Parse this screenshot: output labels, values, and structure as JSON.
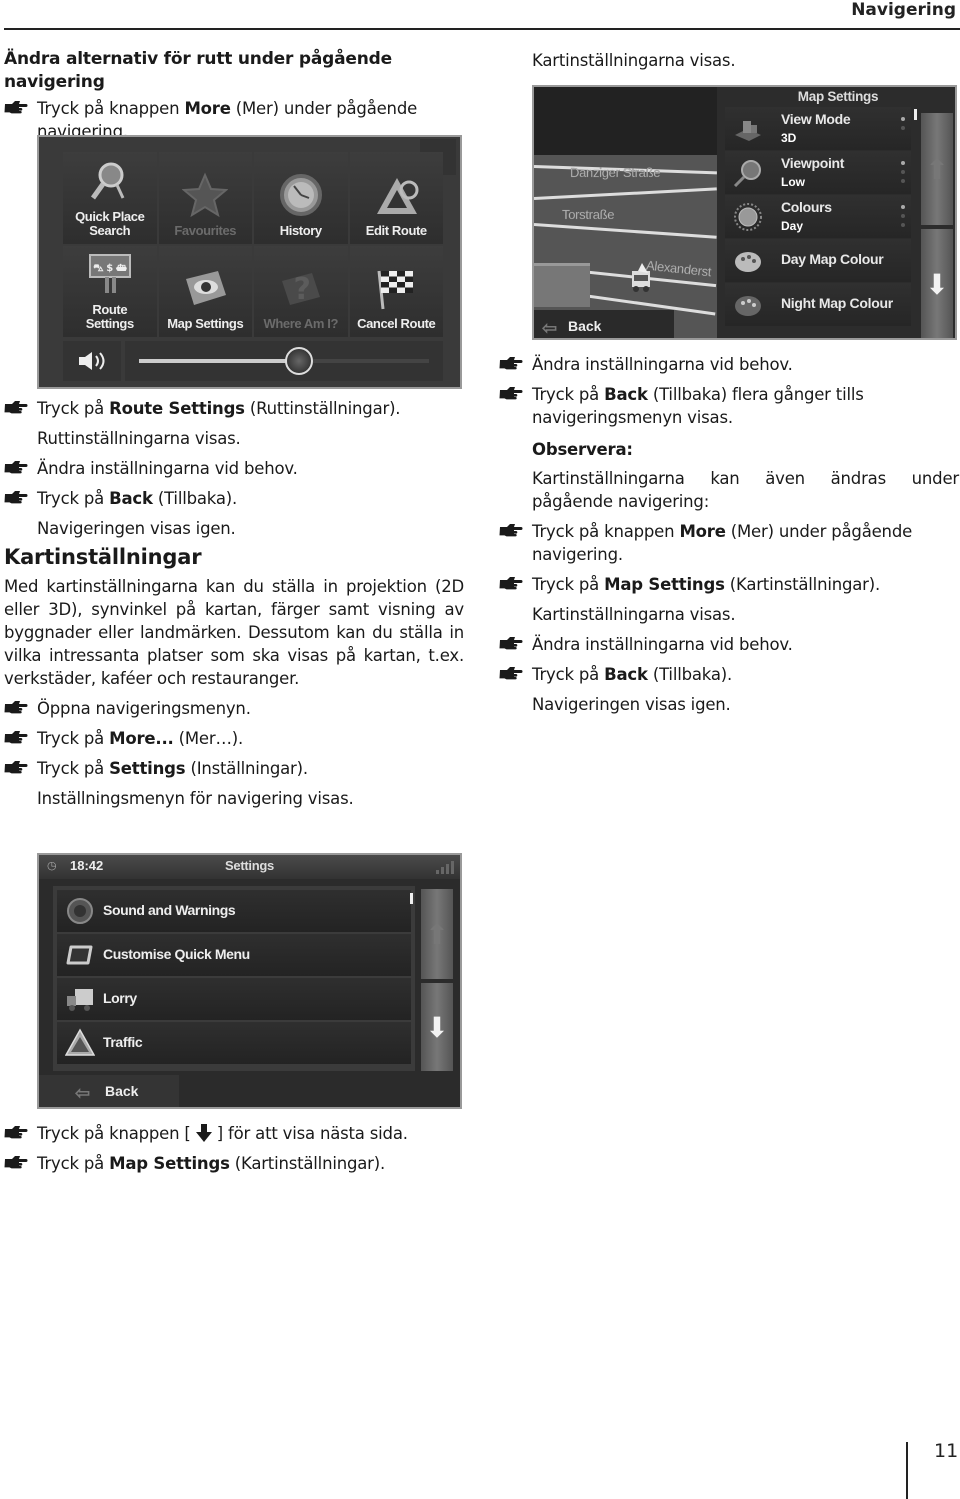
{
  "header": {
    "title": "Navigering"
  },
  "left": {
    "section1_title": "Ändra alternativ för rutt under pågående navigering",
    "step1": {
      "pre": "Tryck på knappen ",
      "bold": "More",
      "post": " (Mer) under pågående navigering."
    },
    "steps_after_more": [
      {
        "pre": "Tryck på ",
        "bold": "Route Settings",
        "post": " (Ruttinställningar)."
      }
    ],
    "note1": "Ruttinställningarna visas.",
    "step3": "Ändra inställningarna vid behov.",
    "step4": {
      "pre": "Tryck på ",
      "bold": "Back",
      "post": " (Tillbaka)."
    },
    "note2": "Navigeringen visas igen.",
    "section2_title": "Kartinställningar",
    "paragraph": "Med kartinställningarna kan du ställa in projektion (2D eller 3D), synvinkel på kartan, färger samt visning av byggnader eller landmärken. Dessutom kan du ställa in vilka intressanta platser som ska visas på kartan, t.ex. verkstäder, kaféer och restauranger.",
    "step5": "Öppna navigeringsmenyn.",
    "step6": {
      "pre": "Tryck på ",
      "bold": "More...",
      "post": " (Mer…)."
    },
    "step7": {
      "pre": "Tryck på ",
      "bold": "Settings",
      "post": " (Inställningar)."
    },
    "note3": "Inställningsmenyn för navigering visas.",
    "step8": {
      "pre": "Tryck på knappen [ ",
      "icon": "down-arrow-icon",
      "post": " ] för att visa nästa sida."
    },
    "step9": {
      "pre": "Tryck på ",
      "bold": "Map Settings",
      "post": " (Kartinställningar)."
    }
  },
  "right": {
    "note_top": "Kartinställningarna visas.",
    "step1": "Ändra inställningarna vid behov.",
    "step2": {
      "pre": "Tryck på ",
      "bold": "Back",
      "post": " (Tillbaka) flera gånger tills navigeringsmenyn visas."
    },
    "obs_head": "Observera:",
    "obs_text": "Kartinställningarna kan även ändras under pågående navigering:",
    "step3": {
      "pre": "Tryck på knappen ",
      "bold": "More",
      "post": " (Mer) under pågående navigering."
    },
    "step4": {
      "pre": "Tryck på ",
      "bold": "Map Settings",
      "post": " (Kartinställningar)."
    },
    "note1": "Kartinställningarna visas.",
    "step5": "Ändra inställningarna vid behov.",
    "step6": {
      "pre": "Tryck på ",
      "bold": "Back",
      "post": " (Tillbaka)."
    },
    "note2": "Navigeringen visas igen."
  },
  "more_menu": {
    "tiles": [
      {
        "label": "Quick Place Search",
        "icon": "magnifier-icon",
        "enabled": true
      },
      {
        "label": "Favourites",
        "icon": "star-icon",
        "enabled": false
      },
      {
        "label": "History",
        "icon": "clock-icon",
        "enabled": true
      },
      {
        "label": "Edit Route",
        "icon": "set-square-icon",
        "enabled": true
      },
      {
        "label": "Route Settings",
        "icon": "road-sign-icon",
        "enabled": true
      },
      {
        "label": "Map Settings",
        "icon": "eye-map-icon",
        "enabled": true
      },
      {
        "label": "Where Am I?",
        "icon": "question-map-icon",
        "enabled": false
      },
      {
        "label": "Cancel Route",
        "icon": "checkered-flag-icon",
        "enabled": true
      }
    ],
    "next_icon": "chevron-right-icon",
    "volume_icon": "speaker-icon",
    "volume_level": 0.55
  },
  "map_settings_screen": {
    "title": "Map Settings",
    "streets": [
      "Danziger Straße",
      "Torstraße",
      "Alexanderst"
    ],
    "items": [
      {
        "label": "View Mode",
        "value": "3D",
        "icon": "buildings-icon"
      },
      {
        "label": "Viewpoint",
        "value": "Low",
        "icon": "magnifier-icon"
      },
      {
        "label": "Colours",
        "value": "Day",
        "icon": "sun-icon"
      },
      {
        "label": "Day Map Colour",
        "value": "",
        "icon": "palette-icon"
      },
      {
        "label": "Night Map Colour",
        "value": "",
        "icon": "palette-dark-icon"
      }
    ],
    "back_label": "Back"
  },
  "settings_screen": {
    "time": "18:42",
    "title": "Settings",
    "items": [
      {
        "label": "Sound and Warnings",
        "icon": "speaker-icon"
      },
      {
        "label": "Customise Quick Menu",
        "icon": "rounded-square-icon"
      },
      {
        "label": "Lorry",
        "icon": "truck-icon"
      },
      {
        "label": "Traffic",
        "icon": "traffic-warning-icon"
      }
    ],
    "back_label": "Back"
  },
  "page_number": "11"
}
